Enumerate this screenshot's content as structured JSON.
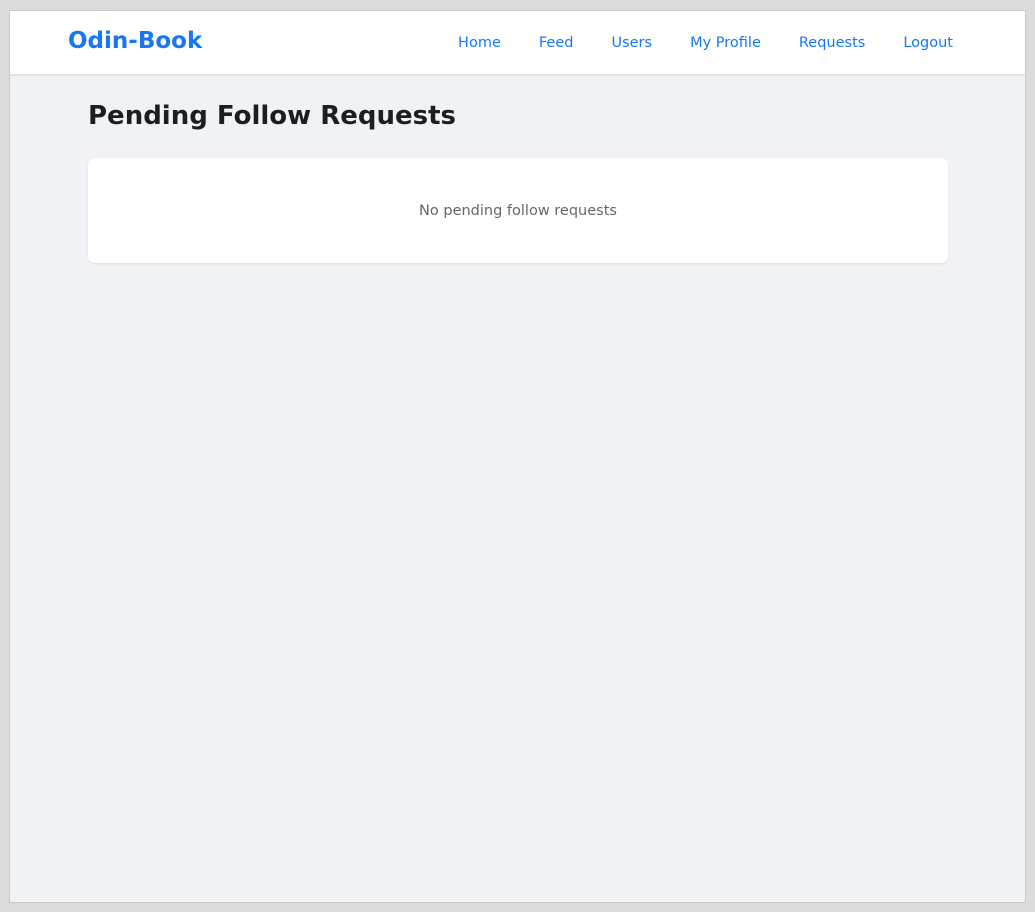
{
  "navbar": {
    "brand": "Odin-Book",
    "links": [
      {
        "label": "Home"
      },
      {
        "label": "Feed"
      },
      {
        "label": "Users"
      },
      {
        "label": "My Profile"
      },
      {
        "label": "Requests"
      },
      {
        "label": "Logout"
      }
    ]
  },
  "main": {
    "title": "Pending Follow Requests",
    "empty_message": "No pending follow requests"
  },
  "colors": {
    "accent": "#1877f2",
    "background": "#f0f2f5",
    "title_text": "#1c1e21",
    "muted_text": "#65676b"
  }
}
